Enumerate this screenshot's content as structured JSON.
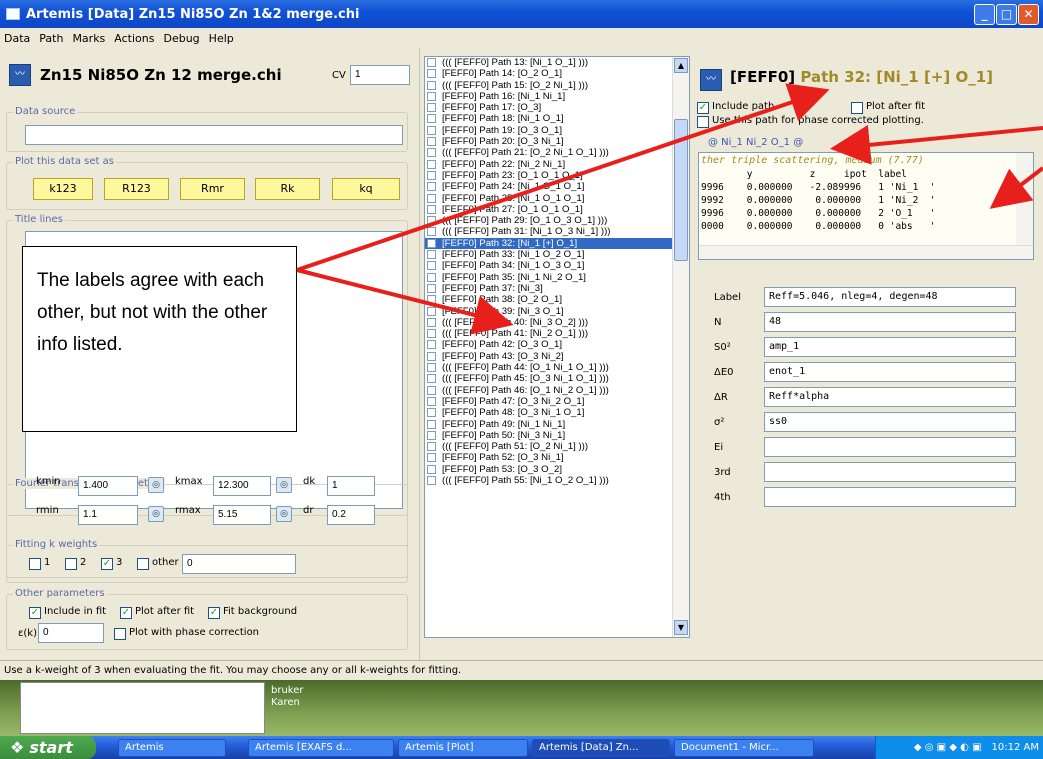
{
  "window": {
    "title": "Artemis [Data] Zn15 Ni85O Zn 1&2 merge.chi"
  },
  "menu": [
    "Data",
    "Path",
    "Marks",
    "Actions",
    "Debug",
    "Help"
  ],
  "left": {
    "data_title": "Zn15 Ni85O Zn 12 merge.chi",
    "cv_label": "CV",
    "cv_value": "1",
    "data_source_legend": "Data source",
    "plot_legend": "Plot this data set as",
    "plot_buttons": [
      "k123",
      "R123",
      "Rmr",
      "Rk",
      "kq"
    ],
    "title_lines_legend": "Title lines",
    "ft_legend": "Fourier transform parameters",
    "kmin_label": "kmin",
    "kmin": "1.400",
    "kmax_label": "kmax",
    "kmax": "12.300",
    "dk_label": "dk",
    "dk": "1",
    "rmin_label": "rmin",
    "rmin": "1.1",
    "rmax_label": "rmax",
    "rmax": "5.15",
    "dr_label": "dr",
    "dr": "0.2",
    "kw_legend": "Fitting k weights",
    "kw1": "1",
    "kw2": "2",
    "kw3": "3",
    "kw_other": "other",
    "kw_other_value": "0",
    "other_legend": "Other parameters",
    "include_fit": "Include in fit",
    "plot_after_fit": "Plot after fit",
    "fit_background": "Fit background",
    "epsilon_label": "ε(k)",
    "epsilon": "0",
    "phase_corr": "Plot with phase correction"
  },
  "paths": [
    "((( [FEFF0] Path 13: [Ni_1  O_1] )))",
    "[FEFF0] Path 14: [O_2  O_1]",
    "((( [FEFF0] Path 15: [O_2  Ni_1] )))",
    "[FEFF0] Path 16: [Ni_1  Ni_1]",
    "[FEFF0] Path 17: [O_3]",
    "[FEFF0] Path 18: [Ni_1  O_1]",
    "[FEFF0] Path 19: [O_3  O_1]",
    "[FEFF0] Path 20: [O_3  Ni_1]",
    "((( [FEFF0] Path 21: [O_2  Ni_1  O_1] )))",
    "[FEFF0] Path 22: [Ni_2  Ni_1]",
    "[FEFF0] Path 23: [O_1  O_1  O_1]",
    "[FEFF0] Path 24: [Ni_1  O_1  O_1]",
    "[FEFF0] Path 25: [Ni_1  O_1  O_1]",
    "[FEFF0] Path 27: [O_1  O_1  O_1]",
    "((( [FEFF0] Path 29: [O_1  O_3  O_1] )))",
    "((( [FEFF0] Path 31: [Ni_1  O_3  Ni_1] )))",
    "[FEFF0] Path 32: [Ni_1  [+]  O_1]",
    "[FEFF0] Path 33: [Ni_1  O_2  O_1]",
    "[FEFF0] Path 34: [Ni_1  O_3  O_1]",
    "[FEFF0] Path 35: [Ni_1  Ni_2  O_1]",
    "[FEFF0] Path 37: [Ni_3]",
    "[FEFF0] Path 38: [O_2  O_1]",
    "[FEFF0] Path 39: [Ni_3  O_1]",
    "((( [FEFF0] Path 40: [Ni_3  O_2] )))",
    "((( [FEFF0] Path 41: [Ni_2  O_1] )))",
    "[FEFF0] Path 42: [O_3  O_1]",
    "[FEFF0] Path 43: [O_3  Ni_2]",
    "((( [FEFF0] Path 44: [O_1  Ni_1  O_1] )))",
    "((( [FEFF0] Path 45: [O_3  Ni_1  O_1] )))",
    "((( [FEFF0] Path 46: [O_1  Ni_2  O_1] )))",
    "[FEFF0] Path 47: [O_3  Ni_2  O_1]",
    "[FEFF0] Path 48: [O_3  Ni_1  O_1]",
    "[FEFF0] Path 49: [Ni_1  Ni_1]",
    "[FEFF0] Path 50: [Ni_3  Ni_1]",
    "((( [FEFF0] Path 51: [O_2  Ni_1] )))",
    "[FEFF0] Path 52: [O_3  Ni_1]",
    "[FEFF0] Path 53: [O_3  O_2]",
    "((( [FEFF0] Path 55: [Ni_1  O_2  O_1] )))"
  ],
  "selected_path_index": 16,
  "right": {
    "path_feff": "[FEFF0]",
    "path_name": "Path 32: [Ni_1  [+]  O_1]",
    "include_path": "Include path",
    "plot_after_fit": "Plot after fit",
    "phase_corr": "Use this path for phase corrected plotting.",
    "atoms_line": "@ Ni_1  Ni_2  O_1  @",
    "desc_line": "ther triple scattering, medium (7.77)",
    "table_header": "        y          z     ipot  label",
    "table_rows": [
      "9996    0.000000   -2.089996   1 'Ni_1  '",
      "9992    0.000000    0.000000   1 'Ni_2  '",
      "9996    0.000000    0.000000   2 'O_1   '",
      "0000    0.000000    0.000000   0 'abs   '"
    ],
    "params": [
      {
        "label": "Label",
        "value": "Reff=5.046, nleg=4, degen=48"
      },
      {
        "label": "N",
        "value": "48"
      },
      {
        "label": "S0²",
        "value": "amp_1"
      },
      {
        "label": "ΔE0",
        "value": "enot_1"
      },
      {
        "label": "ΔR",
        "value": "Reff*alpha"
      },
      {
        "label": "σ²",
        "value": "ss0"
      },
      {
        "label": "Ei",
        "value": ""
      },
      {
        "label": "3rd",
        "value": ""
      },
      {
        "label": "4th",
        "value": ""
      }
    ]
  },
  "status": "Use a k-weight of 3 when evaluating the fit.  You may choose any or all k-weights for fitting.",
  "notebox_lines": [
    "bruker",
    "Karen"
  ],
  "callout": {
    "text": "The labels agree with each other, but not with the other info listed."
  },
  "taskbar": {
    "start": "start",
    "items": [
      "Artemis",
      "Artemis [EXAFS d...",
      "Artemis [Plot]",
      "Artemis [Data] Zn...",
      "Document1 - Micr..."
    ],
    "clock": "10:12 AM"
  },
  "colors": {
    "accent_path": "#a08a2a",
    "selection": "#316ac5",
    "arrow": "#e8201c"
  }
}
